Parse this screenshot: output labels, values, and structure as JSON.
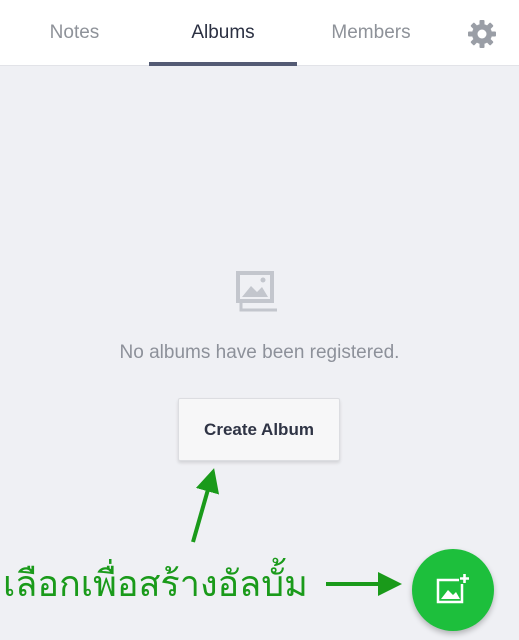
{
  "tabs": [
    {
      "label": "Notes"
    },
    {
      "label": "Albums"
    },
    {
      "label": "Members"
    }
  ],
  "active_tab": "Albums",
  "settings_icon": "gear-icon",
  "empty_state": {
    "icon": "image-stack-icon",
    "message": "No albums have been registered.",
    "button_label": "Create Album"
  },
  "annotation": {
    "text": "เลือกเพื่อสร้างอัลบั้ม"
  },
  "fab": {
    "icon": "add-photo-icon"
  },
  "colors": {
    "tab_indicator": "#545b74",
    "fab": "#1dbf3c",
    "annotation": "#1a9a1a",
    "background": "#eff0f4"
  }
}
